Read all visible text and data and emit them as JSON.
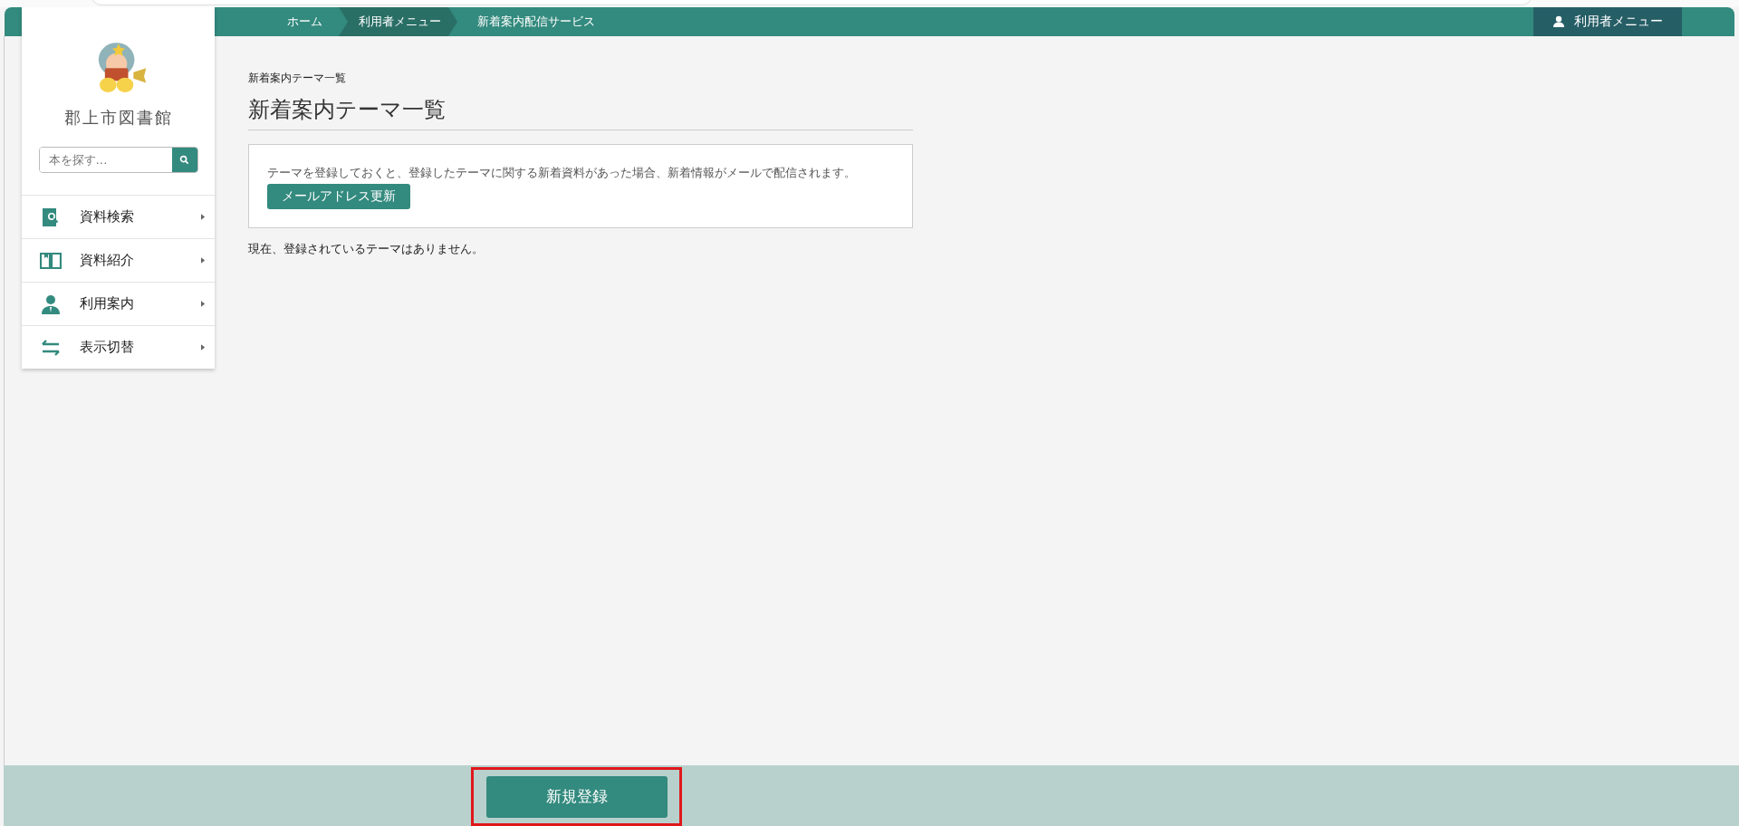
{
  "breadcrumbs": [
    {
      "label": "ホーム",
      "selected": false
    },
    {
      "label": "利用者メニュー",
      "selected": true
    },
    {
      "label": "新着案内配信サービス",
      "selected": false
    }
  ],
  "user_menu": {
    "label": "利用者メニュー"
  },
  "sidebar": {
    "library_name": "郡上市図書館",
    "search": {
      "placeholder": "本を探す…"
    },
    "items": [
      {
        "label": "資料検索",
        "kind": "search"
      },
      {
        "label": "資料紹介",
        "kind": "book"
      },
      {
        "label": "利用案内",
        "kind": "person"
      },
      {
        "label": "表示切替",
        "kind": "switch"
      }
    ]
  },
  "page": {
    "small_title": "新着案内テーマ一覧",
    "title": "新着案内テーマ一覧",
    "notice": "テーマを登録しておくと、登録したテーマに関する新着資料があった場合、新着情報がメールで配信されます。",
    "email_button": "メールアドレス更新",
    "empty_message": "現在、登録されているテーマはありません。"
  },
  "footer": {
    "button": {
      "label": "新規登録",
      "highlighted": true
    }
  }
}
